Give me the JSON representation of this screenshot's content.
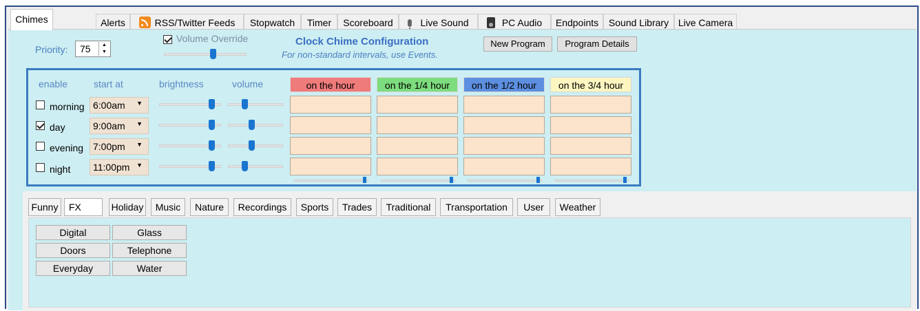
{
  "top_tabs": [
    "Chimes",
    "Alerts",
    "RSS/Twitter Feeds",
    "Stopwatch",
    "Timer",
    "Scoreboard",
    "Live Sound",
    "PC Audio",
    "Endpoints",
    "Sound Library",
    "Live Camera"
  ],
  "priority": {
    "label": "Priority:",
    "value": "75"
  },
  "volume_override": {
    "label": "Volume Override",
    "checked": true
  },
  "config": {
    "title": "Clock Chime Configuration",
    "subtitle": "For non-standard intervals, use Events."
  },
  "buttons": {
    "new_program": "New Program",
    "program_details": "Program Details"
  },
  "columns": {
    "enable": "enable",
    "start_at": "start at",
    "brightness": "brightness",
    "volume": "volume"
  },
  "hour_headers": [
    {
      "label": "on the hour",
      "color": "#ef7b7b"
    },
    {
      "label": "on the 1/4 hour",
      "color": "#7ddc7d"
    },
    {
      "label": "on the 1/2 hour",
      "color": "#5d8fe0"
    },
    {
      "label": "on the 3/4 hour",
      "color": "#fdf6c0"
    }
  ],
  "rows": [
    {
      "label": "morning",
      "checked": false,
      "time": "6:00am",
      "brightness": 0.9,
      "volume": 0.25
    },
    {
      "label": "day",
      "checked": true,
      "time": "9:00am",
      "brightness": 0.9,
      "volume": 0.45
    },
    {
      "label": "evening",
      "checked": false,
      "time": "7:00pm",
      "brightness": 0.9,
      "volume": 0.45
    },
    {
      "label": "night",
      "checked": false,
      "time": "11:00pm",
      "brightness": 0.9,
      "volume": 0.25
    }
  ],
  "category_tabs": [
    "Funny",
    "FX",
    "Holiday",
    "Music",
    "Nature",
    "Recordings",
    "Sports",
    "Trades",
    "Traditional",
    "Transportation",
    "User",
    "Weather"
  ],
  "active_category": "FX",
  "sounds": [
    [
      "Digital",
      "Glass"
    ],
    [
      "Doors",
      "Telephone"
    ],
    [
      "Everyday",
      "Water"
    ]
  ]
}
